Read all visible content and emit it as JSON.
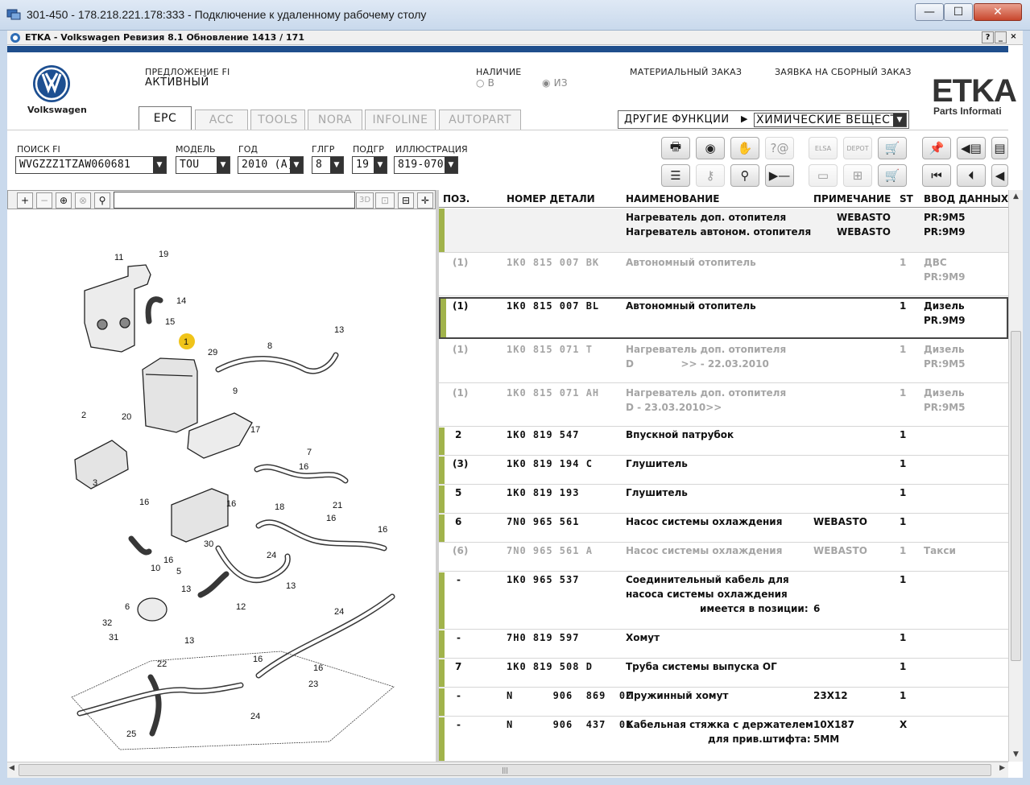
{
  "rdp": {
    "title": "301-450 - 178.218.221.178:333 - Подключение к удаленному рабочему столу",
    "min": "—",
    "max": "☐",
    "close": "✕"
  },
  "app": {
    "title": "ETKA - Volkswagen Ревизия 8.1 Обновление 1413 / 171",
    "help": "?",
    "minimize": "_",
    "close": "×"
  },
  "header": {
    "brand": "Volkswagen",
    "fi_label": "ПРЕДЛОЖЕНИЕ FI",
    "fi_value": "АКТИВНЫЙ",
    "availability_label": "НАЛИЧИЕ",
    "availability_v": "○ В",
    "availability_iz": "◉ ИЗ",
    "material_order": "МАТЕРИАЛЬНЫЙ ЗАКАЗ",
    "assembly_order": "ЗАЯВКА НА СБОРНЫЙ ЗАКАЗ",
    "etka_logo": "ETKA",
    "etka_sub": "Parts Informati"
  },
  "tabs": [
    {
      "label": "EPC",
      "active": true
    },
    {
      "label": "ACC"
    },
    {
      "label": "TOOLS"
    },
    {
      "label": "NORA"
    },
    {
      "label": "INFOLINE"
    },
    {
      "label": "AUTOPART"
    }
  ],
  "other_functions": {
    "label": "ДРУГИЕ ФУНКЦИИ",
    "arrow": "▶",
    "selected": "ХИМИЧЕСКИЕ ВЕЩЕСТВА"
  },
  "filters": {
    "search_label": "ПОИСК FI",
    "search_value": "WVGZZZ1TZAW060681",
    "model_label": "МОДЕЛЬ",
    "model_value": "TOU",
    "year_label": "ГОД",
    "year_value": "2010 (A)",
    "glgr_label": "ГЛГР",
    "glgr_value": "8",
    "podgr_label": "ПОДГР",
    "podgr_value": "19",
    "illu_label": "ИЛЛЮСТРАЦИЯ",
    "illu_value": "819-070"
  },
  "toolbar_icons": [
    "print-icon",
    "cd-icon",
    "handshake-icon",
    "help-question-icon",
    "elsa-icon",
    "depot-icon",
    "cart-down-icon",
    "pin-icon",
    "page-back-icon",
    "page-icon",
    "list-icon",
    "key-icon",
    "bicycle-icon",
    "play-minus-icon",
    "monitor-icon",
    "org-icon",
    "cart-icon",
    "first-icon",
    "prev-icon",
    "back-icon"
  ],
  "toolbar_labels": {
    "elsa": "ELSA",
    "depot": "DEPOT"
  },
  "image_toolbar": {
    "zoom_in": "+",
    "zoom_out": "−",
    "zoom_fit": "⊕",
    "zoom_reset": "⊗",
    "search": "⚲",
    "three_d": "3D"
  },
  "table": {
    "headers": {
      "pos": "ПОЗ.",
      "part_number": "НОМЕР ДЕТАЛИ",
      "name": "НАИМЕНОВАНИЕ",
      "note": "ПРИМЕЧАНИЕ",
      "st": "ST",
      "data_entry": "ВВОД ДАННЫХ"
    },
    "rows": [
      {
        "pos": "",
        "part": "",
        "name1": "Нагреватель доп. отопителя",
        "name2": "Нагреватель автоном. отопителя",
        "note1": "WEBASTO",
        "note2": "WEBASTO",
        "st": "",
        "d1": "PR:9M5",
        "d2": "PR:9M9"
      },
      {
        "pos": "(1)",
        "part": "1K0  815  007  BK",
        "name1": "Автономный отопитель",
        "name2": "",
        "note1": "",
        "st": "1",
        "d1": "ДВС",
        "d2": "PR:9M9"
      },
      {
        "pos": "(1)",
        "part": "1K0  815  007  BL",
        "name1": "Автономный отопитель",
        "name2": "",
        "note1": "",
        "st": "1",
        "d1": "Дизель",
        "d2": "PR.9M9"
      },
      {
        "pos": "(1)",
        "part": "1K0  815  071  T",
        "name1": "Нагреватель доп. отопителя",
        "name2": "D              >> - 22.03.2010",
        "note1": "",
        "st": "1",
        "d1": "Дизель",
        "d2": "PR:9M5"
      },
      {
        "pos": "(1)",
        "part": "1K0  815  071  AH",
        "name1": "Нагреватель доп. отопителя",
        "name2": "D - 23.03.2010>>",
        "note1": "",
        "st": "1",
        "d1": "Дизель",
        "d2": "PR:9M5"
      },
      {
        "pos": "2",
        "part": "1K0  819  547",
        "name1": "Впускной патрубок",
        "note1": "",
        "st": "1",
        "d1": ""
      },
      {
        "pos": "(3)",
        "part": "1K0  819  194  C",
        "name1": "Глушитель",
        "note1": "",
        "st": "1",
        "d1": ""
      },
      {
        "pos": "5",
        "part": "1K0  819  193",
        "name1": "Глушитель",
        "note1": "",
        "st": "1",
        "d1": ""
      },
      {
        "pos": "6",
        "part": "7N0  965  561",
        "name1": "Насос системы охлаждения",
        "note1": "WEBASTO",
        "st": "1",
        "d1": ""
      },
      {
        "pos": "(6)",
        "part": "7N0  965  561  A",
        "name1": "Насос системы охлаждения",
        "note1": "WEBASTO",
        "st": "1",
        "d1": "Такси"
      },
      {
        "pos": "-",
        "part": "1K0  965  537",
        "name1": "Соединительный кабель для",
        "name2": "насоса системы охлаждения",
        "name3": "имеется в позиции:",
        "note3": "6",
        "st": "1",
        "d1": ""
      },
      {
        "pos": "-",
        "part": "7H0  819  597",
        "name1": "Хомут",
        "note1": "",
        "st": "1",
        "d1": ""
      },
      {
        "pos": "7",
        "part": "1K0  819  508  D",
        "name1": "Труба системы выпуска ОГ",
        "note1": "",
        "st": "1",
        "d1": ""
      },
      {
        "pos": "-",
        "part": "N      906  869  02",
        "name1": "Пружинный хомут",
        "note1": "23X12",
        "st": "1",
        "d1": ""
      },
      {
        "pos": "-",
        "part": "N      906  437  01",
        "name1": "Кабельная стяжка с держателем",
        "name2": "для прив.штифта:",
        "note1": "10X187",
        "note2": "5MM",
        "st": "X",
        "d1": ""
      }
    ]
  },
  "diagram": {
    "callouts": [
      "1",
      "2",
      "3",
      "5",
      "6",
      "7",
      "8",
      "9",
      "10",
      "11",
      "12",
      "13",
      "13",
      "13",
      "13",
      "14",
      "15",
      "16",
      "16",
      "16",
      "16",
      "16",
      "16",
      "16",
      "17",
      "18",
      "19",
      "20",
      "21",
      "22",
      "23",
      "24",
      "24",
      "24",
      "25",
      "29",
      "30",
      "31",
      "32"
    ],
    "highlight": "1"
  },
  "scroll": {
    "up": "▲",
    "down": "▼",
    "left": "◀",
    "right": "▶",
    "grip": "|||"
  }
}
